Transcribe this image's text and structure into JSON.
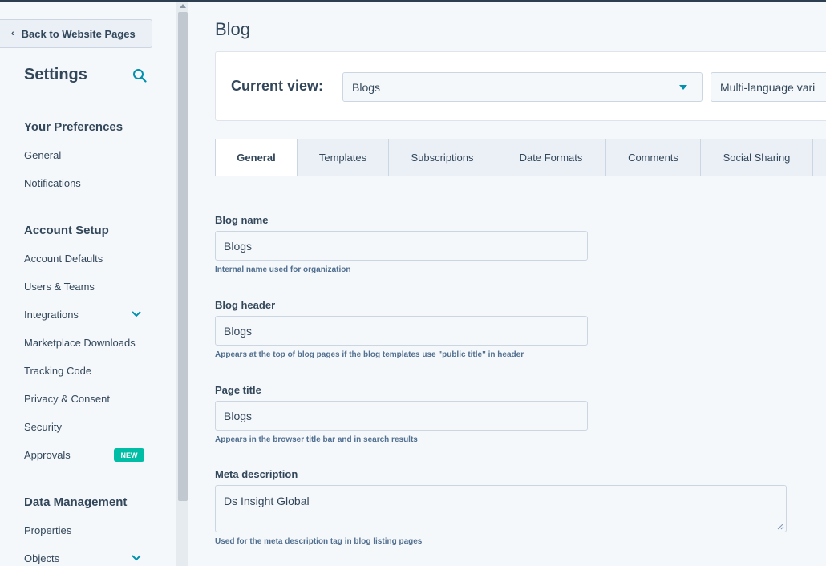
{
  "sidebar": {
    "back_label": "Back to Website Pages",
    "title": "Settings",
    "sections": [
      {
        "heading": "Your Preferences",
        "items": [
          "General",
          "Notifications"
        ]
      },
      {
        "heading": "Account Setup",
        "items": [
          "Account Defaults",
          "Users & Teams",
          "Integrations",
          "Marketplace Downloads",
          "Tracking Code",
          "Privacy & Consent",
          "Security",
          "Approvals"
        ]
      },
      {
        "heading": "Data Management",
        "items": [
          "Properties",
          "Objects"
        ]
      }
    ],
    "new_badge": "NEW"
  },
  "main": {
    "title": "Blog",
    "current_view_label": "Current view:",
    "current_view_value": "Blogs",
    "language_value": "Multi-language vari",
    "tabs": [
      "General",
      "Templates",
      "Subscriptions",
      "Date Formats",
      "Comments",
      "Social Sharing"
    ],
    "active_tab": "General",
    "fields": {
      "blog_name": {
        "label": "Blog name",
        "value": "Blogs",
        "help": "Internal name used for organization"
      },
      "blog_header": {
        "label": "Blog header",
        "value": "Blogs",
        "help": "Appears at the top of blog pages if the blog templates use \"public title\" in header"
      },
      "page_title": {
        "label": "Page title",
        "value": "Blogs",
        "help": "Appears in the browser title bar and in search results"
      },
      "meta_description": {
        "label": "Meta description",
        "value": "Ds Insight Global",
        "help": "Used for the meta description tag in blog listing pages"
      }
    }
  },
  "colors": {
    "accent": "#0091ae",
    "badge": "#00bda5",
    "text": "#33475b",
    "topbar": "#2d3e50"
  }
}
